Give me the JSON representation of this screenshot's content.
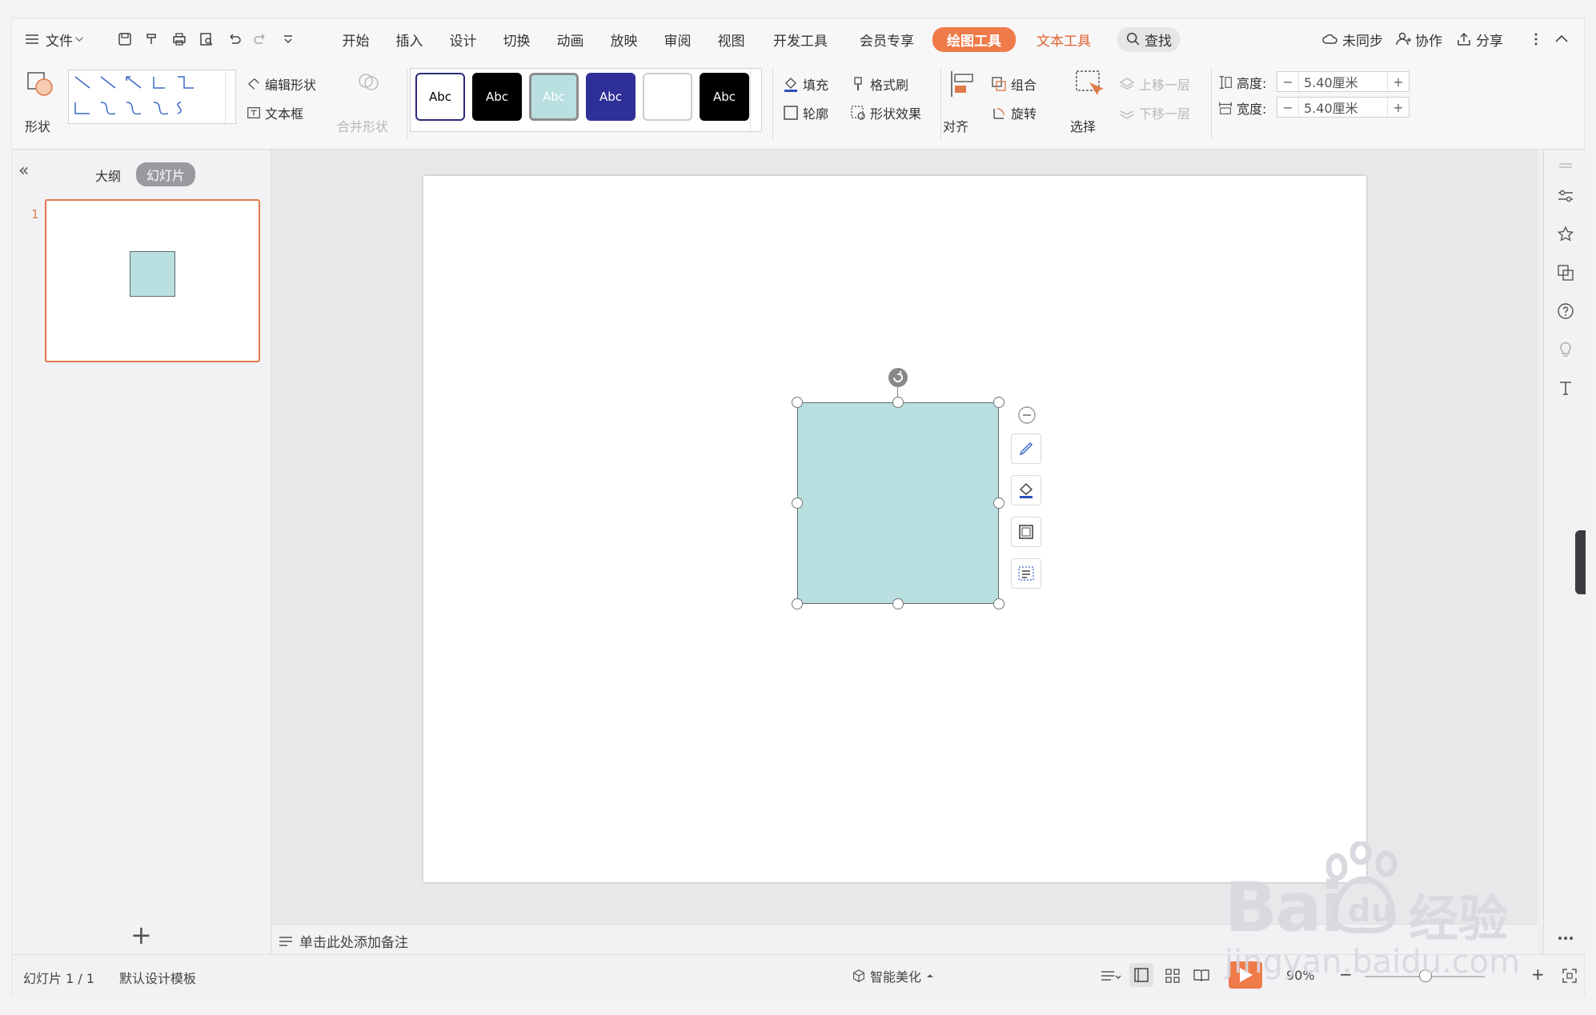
{
  "menu": {
    "file_label": "文件",
    "tabs": [
      "开始",
      "插入",
      "设计",
      "切换",
      "动画",
      "放映",
      "审阅",
      "视图",
      "开发工具",
      "会员专享"
    ],
    "active_tab": "绘图工具",
    "text_tool_tab": "文本工具",
    "search_label": "查找",
    "right": {
      "sync": "未同步",
      "collab": "协作",
      "share": "分享"
    }
  },
  "ribbon": {
    "shape_label": "形状",
    "edit_shape": "编辑形状",
    "textbox": "文本框",
    "merge_shape": "合并形状",
    "styles": [
      {
        "label": "Abc",
        "bg": "#ffffff",
        "fg": "#000000",
        "border": "#2b2b7a"
      },
      {
        "label": "Abc",
        "bg": "#000000",
        "fg": "#ffffff",
        "border": "#000000"
      },
      {
        "label": "Abc",
        "bg": "#b9dfe0",
        "fg": "#ffffff",
        "border": "#8c8c8c"
      },
      {
        "label": "Abc",
        "bg": "#2f2f98",
        "fg": "#ffffff",
        "border": "#2f2f98"
      },
      {
        "label": "",
        "bg": "#ffffff",
        "fg": "#000000",
        "border": "#cccccc"
      },
      {
        "label": "Abc",
        "bg": "#000000",
        "fg": "#ffffff",
        "border": "#000000"
      }
    ],
    "fill": "填充",
    "format_brush": "格式刷",
    "outline": "轮廓",
    "shape_effect": "形状效果",
    "align": "对齐",
    "group": "组合",
    "rotate": "旋转",
    "select": "选择",
    "bring_forward": "上移一层",
    "send_backward": "下移一层",
    "height_label": "高度:",
    "height_value": "5.40厘米",
    "width_label": "宽度:",
    "width_value": "5.40厘米",
    "minus": "−",
    "plus": "+"
  },
  "panel": {
    "collapse": "«",
    "outline_tab": "大纲",
    "slides_tab": "幻灯片",
    "slide_number": "1",
    "add": "+"
  },
  "notes": {
    "placeholder": "单击此处添加备注"
  },
  "status": {
    "slide_info": "幻灯片 1 / 1",
    "template": "默认设计模板",
    "beautify": "智能美化",
    "zoom": "90%",
    "zoom_minus": "−",
    "zoom_plus": "+"
  },
  "watermark": {
    "brand": "Bai",
    "brand2": "经验",
    "url": "jingyan.baidu.com"
  },
  "colors": {
    "accent": "#ef7a4a",
    "shape_fill": "#b9dfe0",
    "thumb_border": "#e07b4a"
  }
}
